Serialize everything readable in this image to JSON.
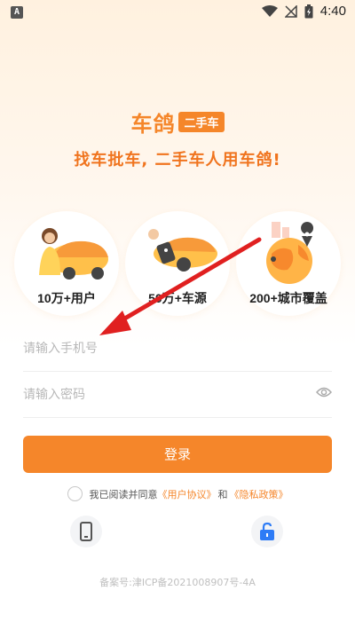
{
  "status_bar": {
    "notification_badge": "A",
    "time": "4:40",
    "icons": [
      "wifi-icon",
      "no-signal-icon",
      "battery-charging-icon"
    ]
  },
  "brand": {
    "name": "车鸽",
    "tag": "二手车",
    "slogan": "找车批车, 二手车人用车鸽!",
    "accent_color": "#f5862a"
  },
  "features": [
    {
      "label": "10万+用户",
      "icon": "user-with-car-icon"
    },
    {
      "label": "50万+车源",
      "icon": "car-key-icon"
    },
    {
      "label": "200+城市覆盖",
      "icon": "globe-location-icon"
    }
  ],
  "form": {
    "phone_placeholder": "请输入手机号",
    "password_placeholder": "请输入密码",
    "login_label": "登录"
  },
  "agreement": {
    "prefix": "我已阅读并同意",
    "user_agreement": "《用户协议》",
    "and": "和",
    "privacy_policy": "《隐私政策》"
  },
  "alt_login": {
    "phone_icon": "phone-icon",
    "lock_icon": "unlock-icon"
  },
  "footer": {
    "icp": "备案号:津ICP备2021008907号-4A"
  }
}
